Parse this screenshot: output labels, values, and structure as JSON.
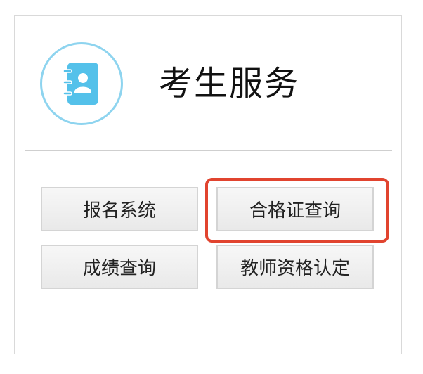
{
  "header": {
    "title": "考生服务",
    "icon": "contacts-book-icon",
    "icon_color": "#54c1ea",
    "ring_color": "#8ed4ef"
  },
  "buttons": [
    {
      "label": "报名系统"
    },
    {
      "label": "合格证查询"
    },
    {
      "label": "成绩查询"
    },
    {
      "label": "教师资格认定"
    }
  ],
  "colors": {
    "highlight": "#e1442f"
  }
}
